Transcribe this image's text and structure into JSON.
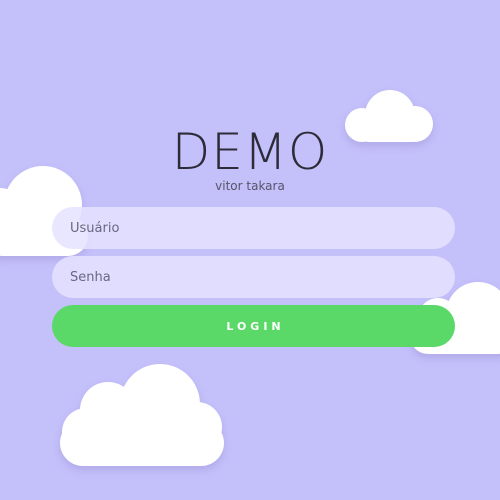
{
  "colors": {
    "background": "#c4c0fa",
    "cloud": "#ffffff",
    "input_fill": "#e5e2ff",
    "login_button": "#5ad868",
    "title_text": "#2e2b38"
  },
  "brand": {
    "title": "DEMO",
    "subtitle": "vitor takara"
  },
  "form": {
    "username_placeholder": "Usuário",
    "password_placeholder": "Senha",
    "login_label": "LOGIN"
  }
}
